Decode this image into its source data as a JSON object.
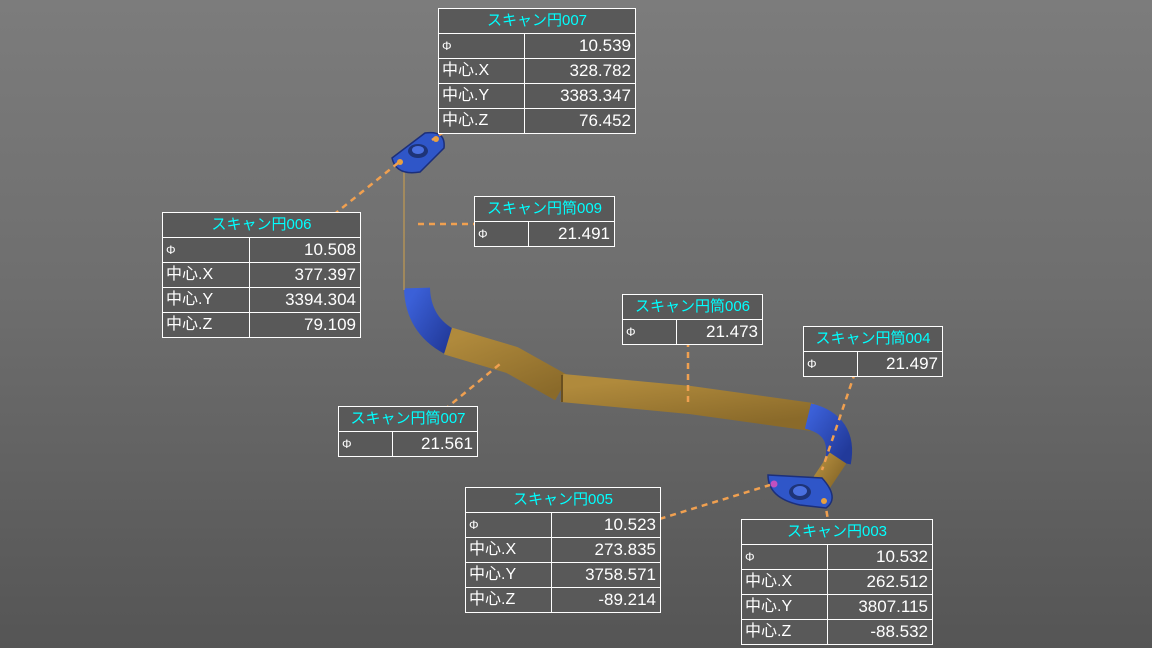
{
  "colors": {
    "leader_line": "#f0a050",
    "header_text": "#00ffff",
    "table_bg": "#595959",
    "pipe_fit": "#a07a32",
    "pipe_bend": "#2f4fc0"
  },
  "symbols": {
    "diameter": "Φ"
  },
  "tables": {
    "circle007": {
      "title": "スキャン円007",
      "rows": [
        {
          "label": "",
          "value": "10.539"
        },
        {
          "label": "中心.X",
          "value": "328.782"
        },
        {
          "label": "中心.Y",
          "value": "3383.347"
        },
        {
          "label": "中心.Z",
          "value": "76.452"
        }
      ]
    },
    "circle006": {
      "title": "スキャン円006",
      "rows": [
        {
          "label": "",
          "value": "10.508"
        },
        {
          "label": "中心.X",
          "value": "377.397"
        },
        {
          "label": "中心.Y",
          "value": "3394.304"
        },
        {
          "label": "中心.Z",
          "value": "79.109"
        }
      ]
    },
    "cyl009": {
      "title": "スキャン円筒009",
      "value": "21.491"
    },
    "cyl006": {
      "title": "スキャン円筒006",
      "value": "21.473"
    },
    "cyl004": {
      "title": "スキャン円筒004",
      "value": "21.497"
    },
    "cyl007": {
      "title": "スキャン円筒007",
      "value": "21.561"
    },
    "circle005": {
      "title": "スキャン円005",
      "rows": [
        {
          "label": "",
          "value": "10.523"
        },
        {
          "label": "中心.X",
          "value": "273.835"
        },
        {
          "label": "中心.Y",
          "value": "3758.571"
        },
        {
          "label": "中心.Z",
          "value": "-89.214"
        }
      ]
    },
    "circle003": {
      "title": "スキャン円003",
      "rows": [
        {
          "label": "",
          "value": "10.532"
        },
        {
          "label": "中心.X",
          "value": "262.512"
        },
        {
          "label": "中心.Y",
          "value": "3807.115"
        },
        {
          "label": "中心.Z",
          "value": "-88.532"
        }
      ]
    }
  }
}
